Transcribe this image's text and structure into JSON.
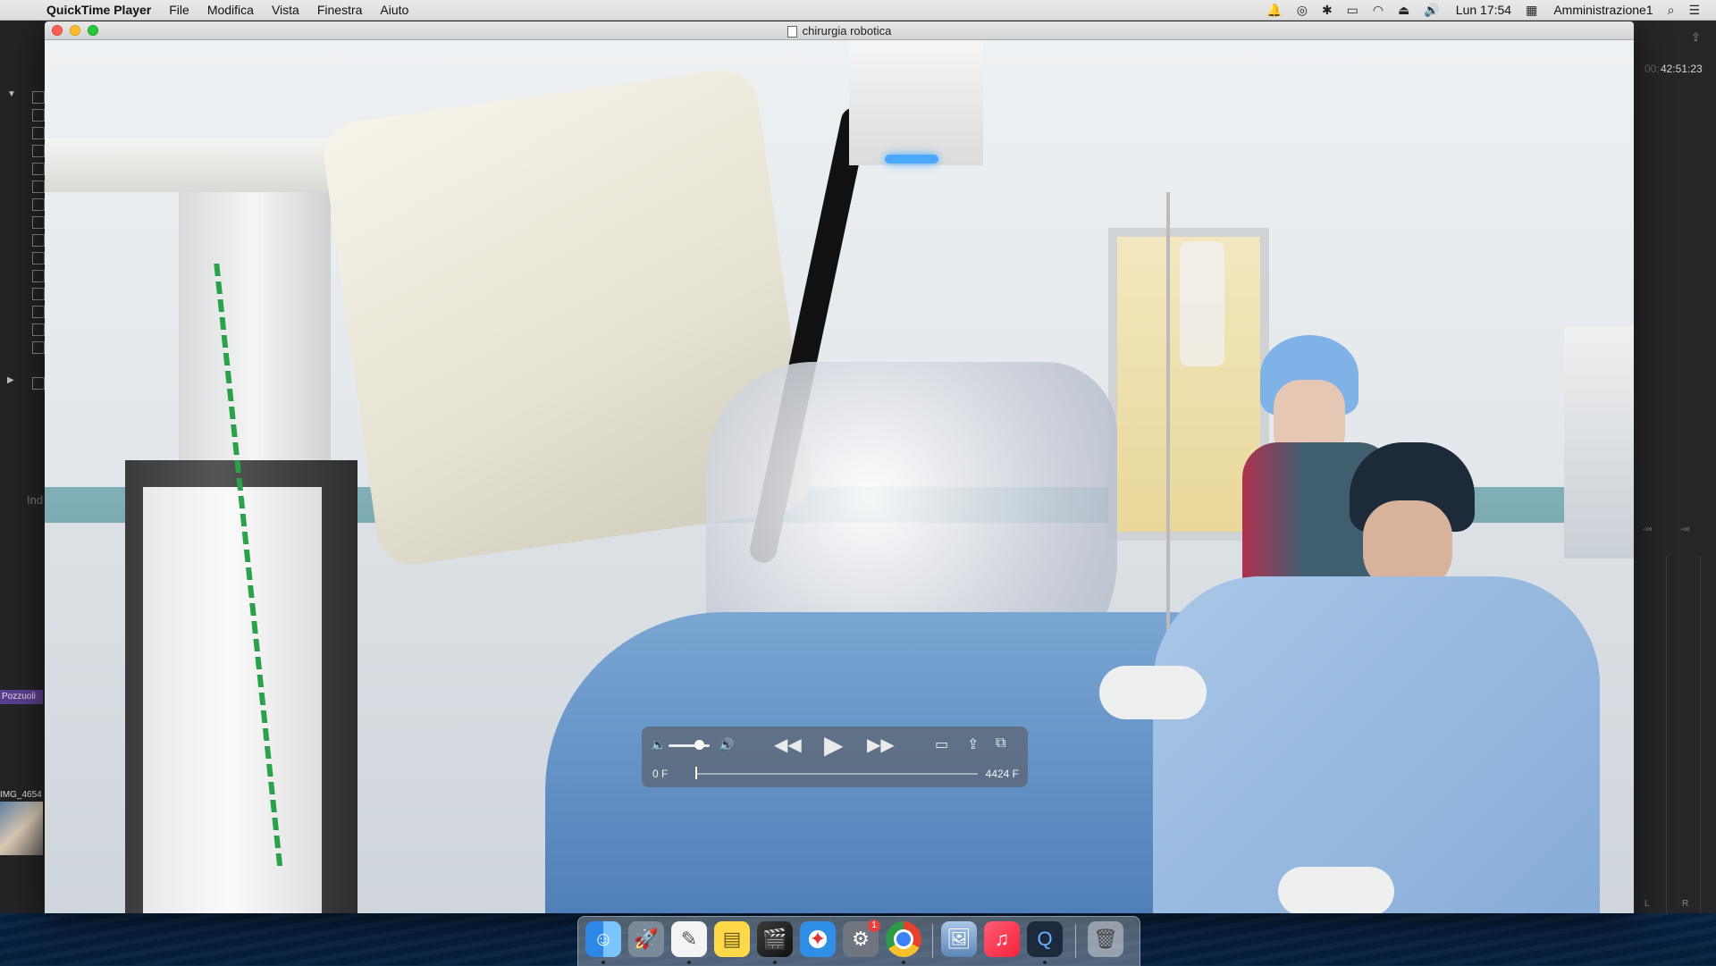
{
  "menubar": {
    "apple_icon": "apple-icon",
    "app_name": "QuickTime Player",
    "menus": [
      "File",
      "Modifica",
      "Vista",
      "Finestra",
      "Aiuto"
    ],
    "clock": "Lun 17:54",
    "user": "Amministrazione1",
    "status_icons": [
      "notification-icon",
      "siri-icon",
      "bluetooth-icon",
      "airplay-icon",
      "wifi-icon",
      "eject-icon",
      "volume-icon"
    ]
  },
  "window": {
    "title": "chirurgia robotica"
  },
  "background_app": {
    "timecode": "42:51:23",
    "timecode_dim": "00:",
    "left_index_label": "Ind",
    "clip_label": "Pozzuoli",
    "image_label": "IMG_4654",
    "meter_labels": [
      "L",
      "R"
    ],
    "minus_inf": "-∞"
  },
  "controls": {
    "time_current": "0 F",
    "time_total": "4424 F",
    "volume_level": 0.75,
    "playhead_position": 0.0
  },
  "dock": {
    "apps": [
      "Finder",
      "Launchpad",
      "TextEdit",
      "Notes",
      "Final Cut Pro",
      "Safari",
      "System Preferences",
      "Google Chrome",
      "Preview",
      "Music",
      "QuickTime Player",
      "Trash"
    ],
    "system_preferences_badge": "1"
  },
  "colors": {
    "accent_red": "#fe5f57",
    "accent_yellow": "#febc2e",
    "accent_green": "#28c840"
  }
}
